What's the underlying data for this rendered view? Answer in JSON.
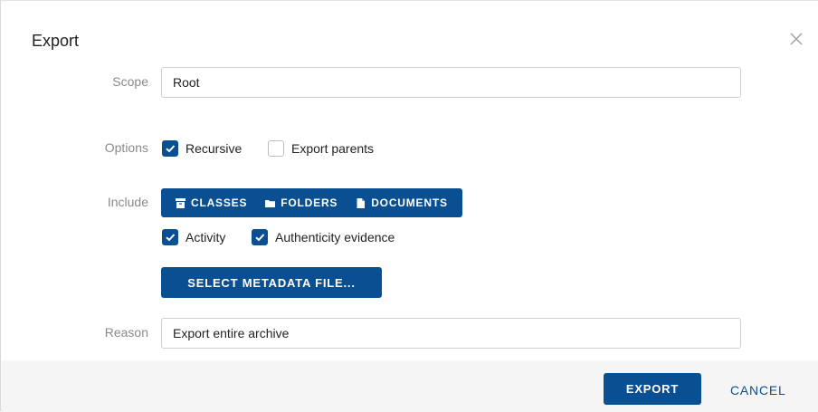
{
  "dialog": {
    "title": "Export",
    "close_icon": "close-icon"
  },
  "scope": {
    "label": "Scope",
    "value": "Root"
  },
  "options": {
    "label": "Options",
    "recursive": {
      "label": "Recursive",
      "checked": true
    },
    "export_parents": {
      "label": "Export parents",
      "checked": false
    }
  },
  "include": {
    "label": "Include",
    "segments": [
      {
        "label": "CLASSES",
        "icon": "archive-box-icon"
      },
      {
        "label": "FOLDERS",
        "icon": "folder-icon"
      },
      {
        "label": "DOCUMENTS",
        "icon": "document-icon"
      }
    ],
    "activity": {
      "label": "Activity",
      "checked": true
    },
    "authenticity": {
      "label": "Authenticity evidence",
      "checked": true
    },
    "metadata_button": "SELECT METADATA FILE..."
  },
  "reason": {
    "label": "Reason",
    "value": "Export entire archive"
  },
  "footer": {
    "export_label": "EXPORT",
    "cancel_label": "CANCEL"
  },
  "colors": {
    "primary": "#0b4f93",
    "footer_bg": "#f5f5f5",
    "label_gray": "#8a8a8a"
  }
}
